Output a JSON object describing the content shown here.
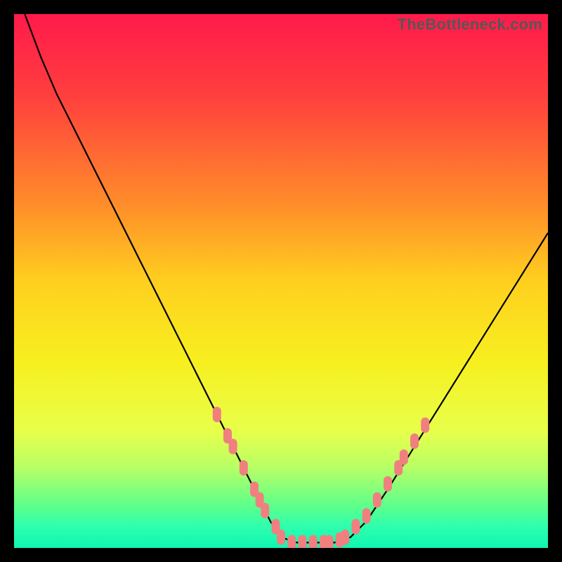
{
  "watermark": "TheBottleneck.com",
  "chart_data": {
    "type": "line",
    "title": "",
    "xlabel": "",
    "ylabel": "",
    "xlim": [
      0,
      100
    ],
    "ylim": [
      0,
      100
    ],
    "gradient_stops": [
      {
        "offset": 0,
        "color": "#ff1a4b"
      },
      {
        "offset": 15,
        "color": "#ff3e3e"
      },
      {
        "offset": 35,
        "color": "#ff8a2a"
      },
      {
        "offset": 50,
        "color": "#ffcf1f"
      },
      {
        "offset": 65,
        "color": "#f7ef1f"
      },
      {
        "offset": 78,
        "color": "#e8ff4a"
      },
      {
        "offset": 85,
        "color": "#b7ff66"
      },
      {
        "offset": 92,
        "color": "#5fff8a"
      },
      {
        "offset": 96,
        "color": "#2effae"
      },
      {
        "offset": 100,
        "color": "#10f5b0"
      }
    ],
    "series": [
      {
        "name": "bottleneck-curve",
        "x": [
          2,
          5,
          8,
          12,
          16,
          20,
          24,
          28,
          32,
          36,
          40,
          44,
          48,
          50,
          53,
          56,
          60,
          63,
          66,
          70,
          75,
          80,
          85,
          90,
          95,
          100
        ],
        "y": [
          100,
          92,
          85,
          77,
          69,
          61,
          53,
          45,
          37,
          29,
          21,
          13,
          5,
          2,
          1,
          1,
          1,
          2,
          5,
          11,
          19,
          27,
          35,
          43,
          51,
          59
        ]
      }
    ],
    "markers": {
      "name": "highlight-points",
      "color": "#f08080",
      "points": [
        {
          "x": 38,
          "y": 25
        },
        {
          "x": 40,
          "y": 21
        },
        {
          "x": 41,
          "y": 19
        },
        {
          "x": 43,
          "y": 15
        },
        {
          "x": 45,
          "y": 11
        },
        {
          "x": 46,
          "y": 9
        },
        {
          "x": 47,
          "y": 7
        },
        {
          "x": 49,
          "y": 4
        },
        {
          "x": 50,
          "y": 2
        },
        {
          "x": 52,
          "y": 1
        },
        {
          "x": 54,
          "y": 1
        },
        {
          "x": 56,
          "y": 1
        },
        {
          "x": 58,
          "y": 1
        },
        {
          "x": 59,
          "y": 1
        },
        {
          "x": 61,
          "y": 1.5
        },
        {
          "x": 62,
          "y": 2
        },
        {
          "x": 64,
          "y": 4
        },
        {
          "x": 66,
          "y": 6
        },
        {
          "x": 68,
          "y": 9
        },
        {
          "x": 70,
          "y": 12
        },
        {
          "x": 72,
          "y": 15
        },
        {
          "x": 73,
          "y": 17
        },
        {
          "x": 75,
          "y": 20
        },
        {
          "x": 77,
          "y": 23
        }
      ]
    }
  }
}
